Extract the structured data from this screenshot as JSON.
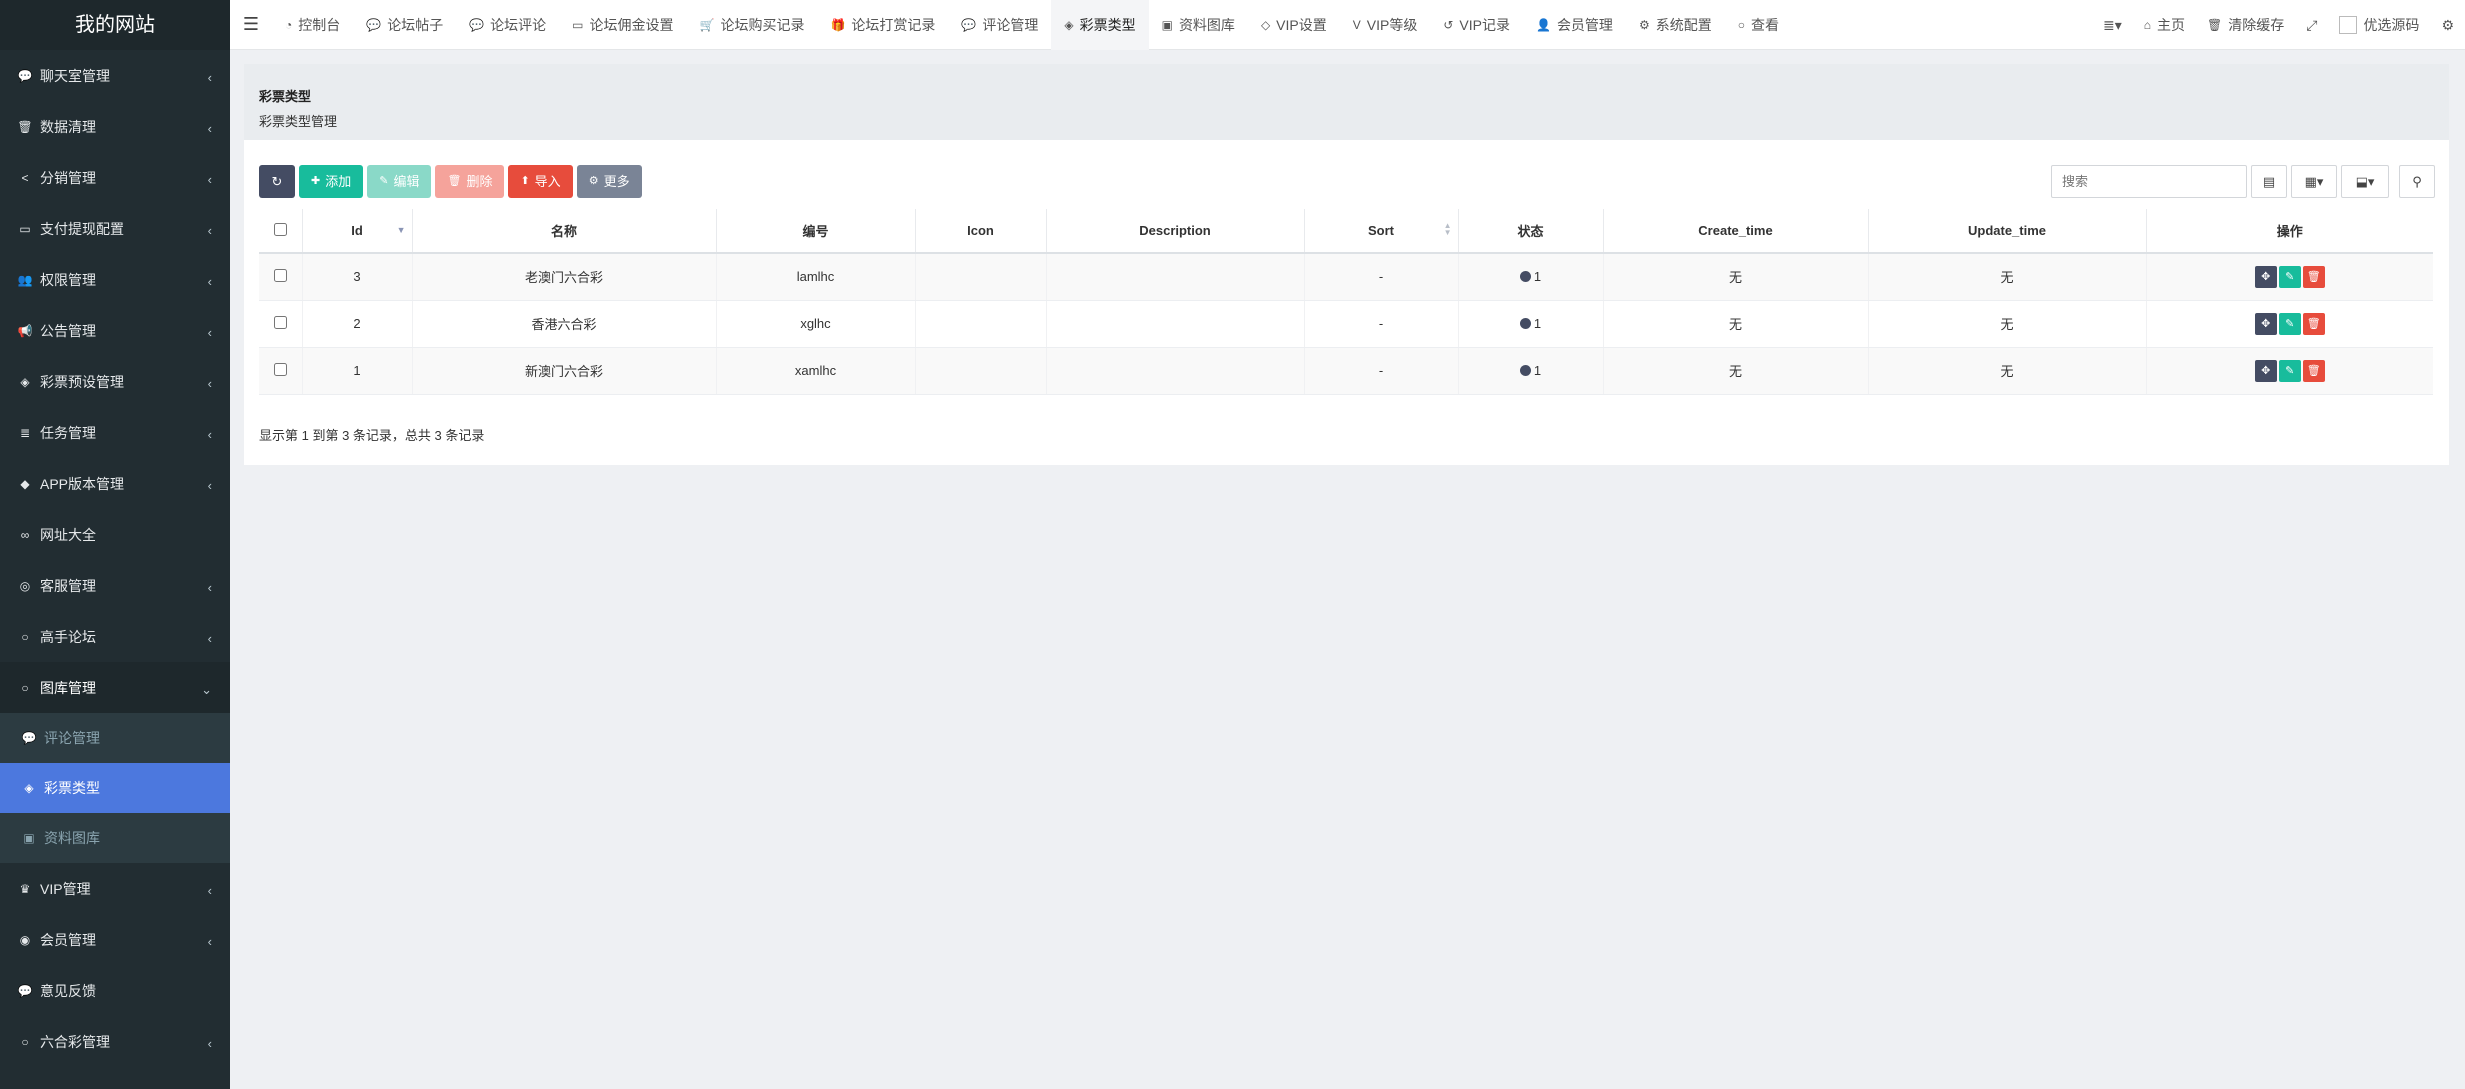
{
  "site_title": "我的网站",
  "sidebar": {
    "items": [
      {
        "label": "聊天室管理",
        "icon": "comments-icon",
        "glyph": "💬"
      },
      {
        "label": "数据清理",
        "icon": "trash-icon",
        "glyph": "🗑"
      },
      {
        "label": "分销管理",
        "icon": "share-icon",
        "glyph": "<"
      },
      {
        "label": "支付提现配置",
        "icon": "money-icon",
        "glyph": "▭"
      },
      {
        "label": "权限管理",
        "icon": "group-icon",
        "glyph": "👥"
      },
      {
        "label": "公告管理",
        "icon": "bullhorn-icon",
        "glyph": "📢"
      },
      {
        "label": "彩票预设管理",
        "icon": "ticket-icon",
        "glyph": "◈"
      },
      {
        "label": "任务管理",
        "icon": "list-icon",
        "glyph": "≣"
      },
      {
        "label": "APP版本管理",
        "icon": "android-icon",
        "glyph": "◆"
      },
      {
        "label": "网址大全",
        "icon": "link-icon",
        "glyph": "∞"
      },
      {
        "label": "客服管理",
        "icon": "headphones-icon",
        "glyph": "◎"
      },
      {
        "label": "高手论坛",
        "icon": "circle-icon",
        "glyph": "○"
      },
      {
        "label": "图库管理",
        "icon": "circle-icon",
        "glyph": "○"
      }
    ],
    "submenu": [
      {
        "label": "评论管理",
        "icon": "comments-icon",
        "glyph": "💬"
      },
      {
        "label": "彩票类型",
        "icon": "ticket-icon",
        "glyph": "◈"
      },
      {
        "label": "资料图库",
        "icon": "image-icon",
        "glyph": "▣"
      }
    ],
    "items_after": [
      {
        "label": "VIP管理",
        "icon": "vip-icon",
        "glyph": "♛"
      },
      {
        "label": "会员管理",
        "icon": "user-circle-icon",
        "glyph": "◉"
      },
      {
        "label": "意见反馈",
        "icon": "comment-icon",
        "glyph": "💬"
      },
      {
        "label": "六合彩管理",
        "icon": "circle-icon",
        "glyph": "○"
      }
    ]
  },
  "topnav": {
    "tabs": [
      {
        "label": "控制台",
        "icon": "dashboard-icon",
        "glyph": "◔"
      },
      {
        "label": "论坛帖子",
        "icon": "comment-icon",
        "glyph": "💬"
      },
      {
        "label": "论坛评论",
        "icon": "comments-icon",
        "glyph": "💬"
      },
      {
        "label": "论坛佣金设置",
        "icon": "money-icon",
        "glyph": "▭"
      },
      {
        "label": "论坛购买记录",
        "icon": "cart-icon",
        "glyph": "🛒"
      },
      {
        "label": "论坛打赏记录",
        "icon": "gift-icon",
        "glyph": "🎁"
      },
      {
        "label": "评论管理",
        "icon": "comments-icon",
        "glyph": "💬"
      },
      {
        "label": "彩票类型",
        "icon": "ticket-icon",
        "glyph": "◈"
      },
      {
        "label": "资料图库",
        "icon": "image-icon",
        "glyph": "▣"
      },
      {
        "label": "VIP设置",
        "icon": "diamond-icon",
        "glyph": "◇"
      },
      {
        "label": "VIP等级",
        "icon": "vimeo-icon",
        "glyph": "V"
      },
      {
        "label": "VIP记录",
        "icon": "history-icon",
        "glyph": "↺"
      },
      {
        "label": "会员管理",
        "icon": "user-icon",
        "glyph": "👤"
      },
      {
        "label": "系统配置",
        "icon": "cog-icon",
        "glyph": "⚙"
      },
      {
        "label": "查看",
        "icon": "circle-icon",
        "glyph": "○"
      }
    ],
    "right": {
      "menu_glyph": "≣▾",
      "home_label": "主页",
      "clear_cache_label": "清除缓存",
      "fullscreen_glyph": "⤢",
      "avatar_alt": "优选源码",
      "settings_glyph": "⚙"
    }
  },
  "page": {
    "title": "彩票类型",
    "subtitle": "彩票类型管理"
  },
  "toolbar": {
    "refresh_glyph": "↻",
    "add_label": "添加",
    "edit_label": "编辑",
    "delete_label": "删除",
    "import_label": "导入",
    "more_label": "更多",
    "search_placeholder": "搜索"
  },
  "table": {
    "headers": [
      "Id",
      "名称",
      "编号",
      "Icon",
      "Description",
      "Sort",
      "状态",
      "Create_time",
      "Update_time",
      "操作"
    ],
    "rows": [
      {
        "id": "3",
        "name": "老澳门六合彩",
        "code": "lamlhc",
        "icon": "",
        "description": "",
        "sort": "-",
        "status": "1",
        "create_time": "无",
        "update_time": "无"
      },
      {
        "id": "2",
        "name": "香港六合彩",
        "code": "xglhc",
        "icon": "",
        "description": "",
        "sort": "-",
        "status": "1",
        "create_time": "无",
        "update_time": "无"
      },
      {
        "id": "1",
        "name": "新澳门六合彩",
        "code": "xamlhc",
        "icon": "",
        "description": "",
        "sort": "-",
        "status": "1",
        "create_time": "无",
        "update_time": "无"
      }
    ]
  },
  "pagination": {
    "summary": "显示第 1 到第 3 条记录，总共 3 条记录"
  }
}
